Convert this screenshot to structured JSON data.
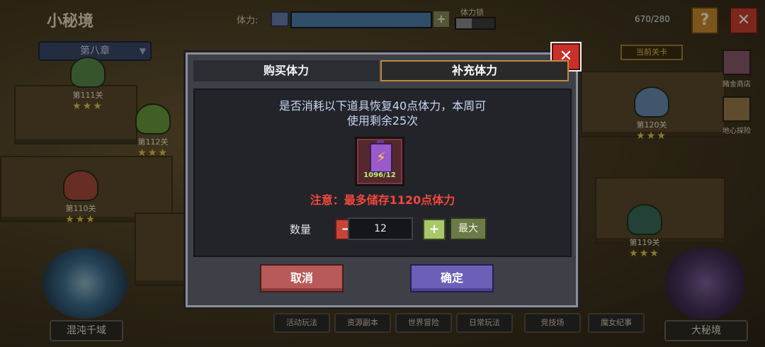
{
  "map": {
    "title": "小秘境",
    "chapter": "第八章",
    "stamina_label": "体力:",
    "stamina_value": "670/280",
    "stamina_fill_fraction": 1.0,
    "lock_label": "体力锁",
    "help_glyph": "?",
    "close_glyph": "✕",
    "current_stage_tag": "当前关卡"
  },
  "stages": [
    {
      "label": "第111关",
      "stars": "★★★",
      "color": "#5a8a4a"
    },
    {
      "label": "第112关",
      "stars": "★★★",
      "color": "#6a9a3a"
    },
    {
      "label": "第110关",
      "stars": "★★★",
      "color": "#a84a3a"
    },
    {
      "label": "第120关",
      "stars": "★★★",
      "color": "#6a8ab0"
    },
    {
      "label": "第119关",
      "stars": "★★★",
      "color": "#3a6a5a"
    }
  ],
  "side_nav": [
    {
      "label": "赌金商店",
      "icon": "treasure-chest-icon",
      "color": "#8a5a6a"
    },
    {
      "label": "地心探险",
      "icon": "crystal-icon",
      "color": "#9a7a4a"
    }
  ],
  "bottom": {
    "chaos_label": "混沌千域",
    "big_realm_label": "大秘境",
    "tabs": [
      "活动玩法",
      "资源副本",
      "世界冒险",
      "日常玩法",
      "竞技场",
      "魔女纪事"
    ]
  },
  "dialog": {
    "tab_buy": "购买体力",
    "tab_refill": "补充体力",
    "prompt_line1": "是否消耗以下道具恢复40点体力，本周可",
    "prompt_line2": "使用剩余25次",
    "item_icon": "energy-battery-icon",
    "item_count": "1096/12",
    "warning": "注意：最多储存1120点体力",
    "qty_label": "数量",
    "qty_minus": "−",
    "qty_value": "12",
    "qty_plus": "+",
    "qty_max": "最大",
    "cancel": "取消",
    "confirm": "确定",
    "close_glyph": "✕"
  },
  "colors": {
    "accent_tab_border": "#c08a3a",
    "warning": "#f0483a",
    "cancel": "#b85a58",
    "confirm": "#6a60b8"
  }
}
